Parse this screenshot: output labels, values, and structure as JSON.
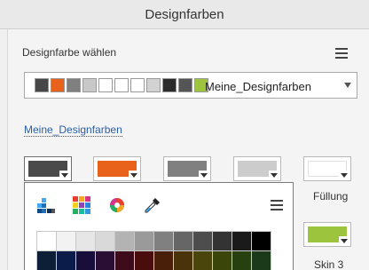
{
  "header": {
    "title": "Designfarben"
  },
  "theme_section": {
    "label": "Designfarbe wählen",
    "selected_theme": "Meine_Designfarben",
    "swatches": [
      "#474747",
      "#e8621c",
      "#7f7f7f",
      "#c8c8c8",
      "#ffffff",
      "#ffffff",
      "#ffffff",
      "#d2d2d2",
      "#2b2b2b",
      "#555555",
      "#9dc43c"
    ]
  },
  "theme_link": "Meine_Designfarben",
  "color_slots": [
    {
      "label": "",
      "color": "#4a4a4a"
    },
    {
      "label": "",
      "color": "#e8621c"
    },
    {
      "label": "",
      "color": "#808080"
    },
    {
      "label": "",
      "color": "#cccccc"
    },
    {
      "label": "Füllung",
      "color": "#ffffff"
    },
    {
      "label": "Skin 3",
      "color": "#9cc43c"
    }
  ],
  "picker": {
    "icons": [
      "swatches-icon",
      "color-grid-icon",
      "color-wheel-icon",
      "eyedropper-icon"
    ],
    "grid_colors": [
      [
        "#ffffff",
        "#f2f2f2",
        "#e6e6e6",
        "#d9d9d9",
        "#b3b3b3",
        "#9a9a9a",
        "#808080",
        "#666666",
        "#4d4d4d",
        "#333333",
        "#1a1a1a",
        "#000000"
      ],
      [
        "#0d1f36",
        "#0b1c4a",
        "#170e3a",
        "#2a0e33",
        "#3d0b1a",
        "#4a0d0d",
        "#4a1f0a",
        "#4a330a",
        "#4a450a",
        "#3a450a",
        "#26400f",
        "#1a3a1a"
      ]
    ]
  }
}
